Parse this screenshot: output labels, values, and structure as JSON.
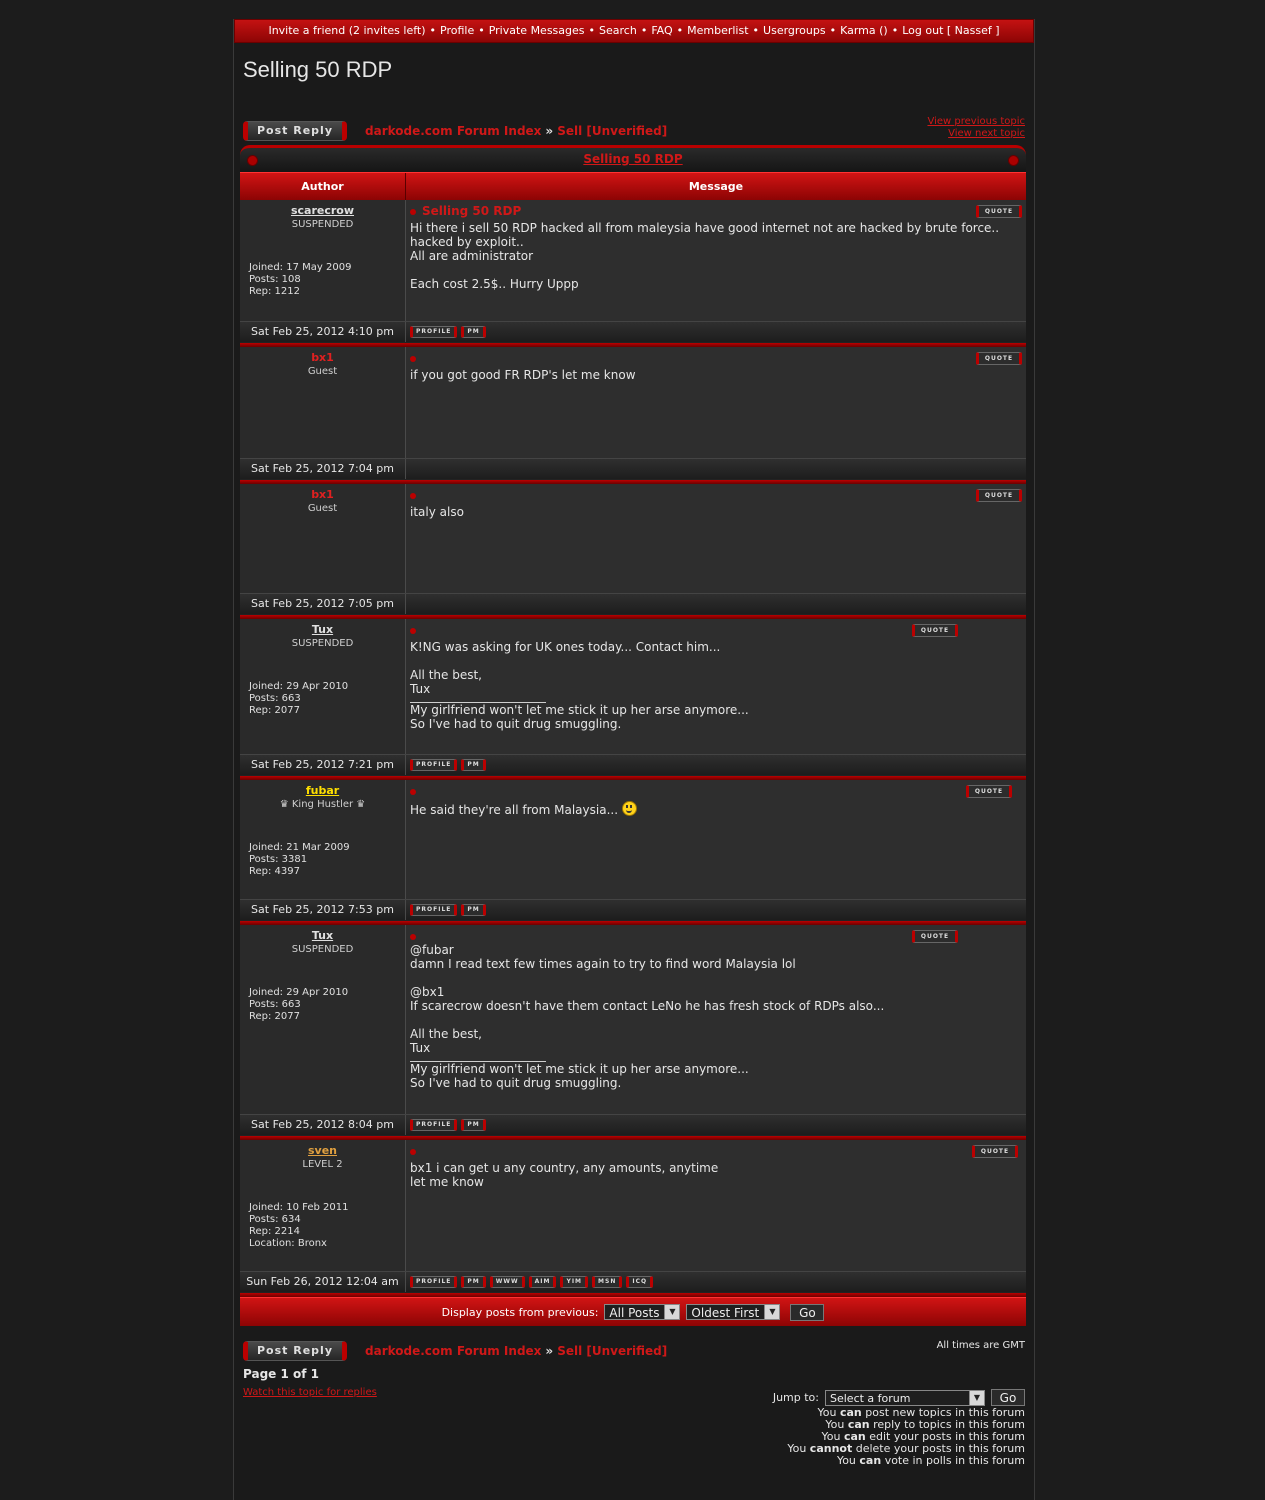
{
  "nav": {
    "items": [
      "Invite a friend (2 invites left)",
      "Profile",
      "Private Messages",
      "Search",
      "FAQ",
      "Memberlist",
      "Usergroups",
      "Karma ()",
      "Log out [ Nassef ]"
    ],
    "separator": "•"
  },
  "page_title": "Selling 50 RDP",
  "breadcrumb": {
    "index": "darkode.com Forum Index",
    "separator": "»",
    "forum": "Sell [Unverified]"
  },
  "post_reply_label": "Post Reply",
  "topic_links": {
    "previous": "View previous topic",
    "next": "View next topic"
  },
  "table": {
    "topic_title": "Selling 50 RDP",
    "col_author": "Author",
    "col_message": "Message"
  },
  "button_labels": {
    "quote": "QUOTE",
    "profile": "PROFILE",
    "pm": "PM",
    "www": "WWW",
    "aim": "AIM",
    "yim": "YIM",
    "msn": "MSN",
    "icq": "ICQ"
  },
  "colors": {
    "accent": "#d01818",
    "bar_red": "#c41212",
    "fubar": "#ffe000",
    "sven": "#e0a040",
    "bx1": "#e02020"
  },
  "posts": [
    {
      "author": "scarecrow",
      "rank": "SUSPENDED",
      "stats": [
        "Joined: 17 May 2009",
        "Posts: 108",
        "Rep: 1212"
      ],
      "subject": "Selling 50 RDP",
      "body": "Hi there i sell 50 RDP hacked all from maleysia have good internet not are hacked by brute force..\nhacked by exploit..\nAll are administrator\n\nEach cost 2.5$.. Hurry Uppp",
      "signature": "",
      "date": "Sat Feb 25, 2012 4:10 pm",
      "buttons": [
        "PROFILE",
        "PM"
      ]
    },
    {
      "author": "bx1",
      "rank": "Guest",
      "stats": [],
      "subject": "",
      "body": "if you got good FR RDP's let me know",
      "signature": "",
      "date": "Sat Feb 25, 2012 7:04 pm",
      "buttons": []
    },
    {
      "author": "bx1",
      "rank": "Guest",
      "stats": [],
      "subject": "",
      "body": "italy also",
      "signature": "",
      "date": "Sat Feb 25, 2012 7:05 pm",
      "buttons": []
    },
    {
      "author": "Tux",
      "rank": "SUSPENDED",
      "stats": [
        "Joined: 29 Apr 2010",
        "Posts: 663",
        "Rep: 2077"
      ],
      "subject": "",
      "body": "K!NG was asking for UK ones today... Contact him...\n\nAll the best,\nTux",
      "signature": "My girlfriend won't let me stick it up her arse anymore...\nSo I've had to quit drug smuggling.",
      "date": "Sat Feb 25, 2012 7:21 pm",
      "buttons": [
        "PROFILE",
        "PM"
      ]
    },
    {
      "author": "fubar",
      "rank": "♛ King Hustler ♛",
      "stats": [
        "Joined: 21 Mar 2009",
        "Posts: 3381",
        "Rep: 4397"
      ],
      "subject": "",
      "body": "He said they're all from Malaysia...",
      "signature": "",
      "date": "Sat Feb 25, 2012 7:53 pm",
      "buttons": [
        "PROFILE",
        "PM"
      ]
    },
    {
      "author": "Tux",
      "rank": "SUSPENDED",
      "stats": [
        "Joined: 29 Apr 2010",
        "Posts: 663",
        "Rep: 2077"
      ],
      "subject": "",
      "body": "@fubar\ndamn I read text few times again to try to find word Malaysia lol\n\n@bx1\nIf scarecrow doesn't have them contact LeNo he has fresh stock of RDPs also...\n\nAll the best,\nTux",
      "signature": "My girlfriend won't let me stick it up her arse anymore...\nSo I've had to quit drug smuggling.",
      "date": "Sat Feb 25, 2012 8:04 pm",
      "buttons": [
        "PROFILE",
        "PM"
      ]
    },
    {
      "author": "sven",
      "rank": "LEVEL 2",
      "stats": [
        "Joined: 10 Feb 2011",
        "Posts: 634",
        "Rep: 2214",
        "Location: Bronx"
      ],
      "subject": "",
      "body": "bx1 i can get u any country, any amounts, anytime\nlet me know",
      "signature": "",
      "date": "Sun Feb 26, 2012 12:04 am",
      "buttons": [
        "PROFILE",
        "PM",
        "WWW",
        "AIM",
        "YIM",
        "MSN",
        "ICQ"
      ]
    }
  ],
  "display_options": {
    "label": "Display posts from previous:",
    "posts_select": "All Posts",
    "order_select": "Oldest First",
    "go": "Go"
  },
  "timezone_note": "All times are GMT",
  "page_info": "Page 1 of 1",
  "watch_link": "Watch this topic for replies",
  "jump": {
    "label": "Jump to:",
    "select": "Select a forum",
    "go": "Go"
  },
  "permissions": [
    {
      "pre": "You",
      "verb": "can",
      "post": "post new topics in this forum"
    },
    {
      "pre": "You",
      "verb": "can",
      "post": "reply to topics in this forum"
    },
    {
      "pre": "You",
      "verb": "can",
      "post": "edit your posts in this forum"
    },
    {
      "pre": "You",
      "verb": "cannot",
      "post": "delete your posts in this forum"
    },
    {
      "pre": "You",
      "verb": "can",
      "post": "vote in polls in this forum"
    }
  ]
}
